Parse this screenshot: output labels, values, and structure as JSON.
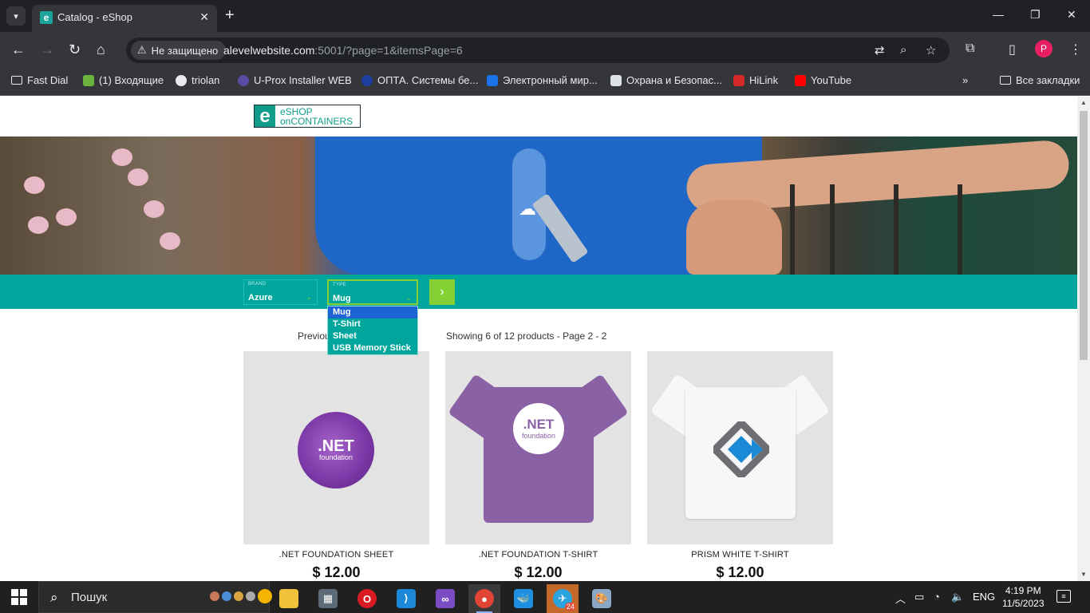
{
  "browser": {
    "tab_title": "Catalog - eShop",
    "not_secure_label": "Не защищено",
    "url_host": "alevelwebsite.com",
    "url_rest": ":5001/?page=1&itemsPage=6",
    "profile_initial": "P"
  },
  "bookmarks": [
    {
      "label": "Fast Dial",
      "icon": "folder-icon"
    },
    {
      "label": "(1) Входящие",
      "icon": "mail-icon"
    },
    {
      "label": "triolan",
      "icon": "globe-icon"
    },
    {
      "label": "U-Prox Installer WEB",
      "icon": "uprox-icon"
    },
    {
      "label": "ОПТА. Системы бе...",
      "icon": "opta-icon"
    },
    {
      "label": "Электронный мир...",
      "icon": "emir-icon"
    },
    {
      "label": "Охрана и Безопас...",
      "icon": "security-icon"
    },
    {
      "label": "HiLink",
      "icon": "huawei-icon"
    },
    {
      "label": "YouTube",
      "icon": "youtube-icon"
    }
  ],
  "bookmarks_all_label": "Все закладки",
  "logo": {
    "line1": "eSHOP",
    "line2": "onCONTAINERS"
  },
  "filters": {
    "brand_label": "BRAND",
    "brand_value": "Azure",
    "type_label": "TYPE",
    "type_value": "Mug",
    "type_options": [
      "Mug",
      "T-Shirt",
      "Sheet",
      "USB Memory Stick"
    ]
  },
  "pager": {
    "previous_label": "Previous",
    "showing_text": "Showing 6 of 12 products - Page 2 - 2"
  },
  "products": [
    {
      "name": ".NET FOUNDATION SHEET",
      "price": "$ 12.00"
    },
    {
      "name": ".NET FOUNDATION T-SHIRT",
      "price": "$ 12.00"
    },
    {
      "name": "PRISM WHITE T-SHIRT",
      "price": "$ 12.00"
    }
  ],
  "net_logo": {
    "net": ".NET",
    "foundation": "foundation"
  },
  "taskbar": {
    "search_placeholder": "Пошук",
    "language": "ENG",
    "time": "4:19 PM",
    "date": "11/5/2023",
    "telegram_badge": "24"
  },
  "colors": {
    "brand_teal": "#00a69c",
    "accent_green": "#83d135",
    "dropdown_selected": "#1e63d6"
  }
}
